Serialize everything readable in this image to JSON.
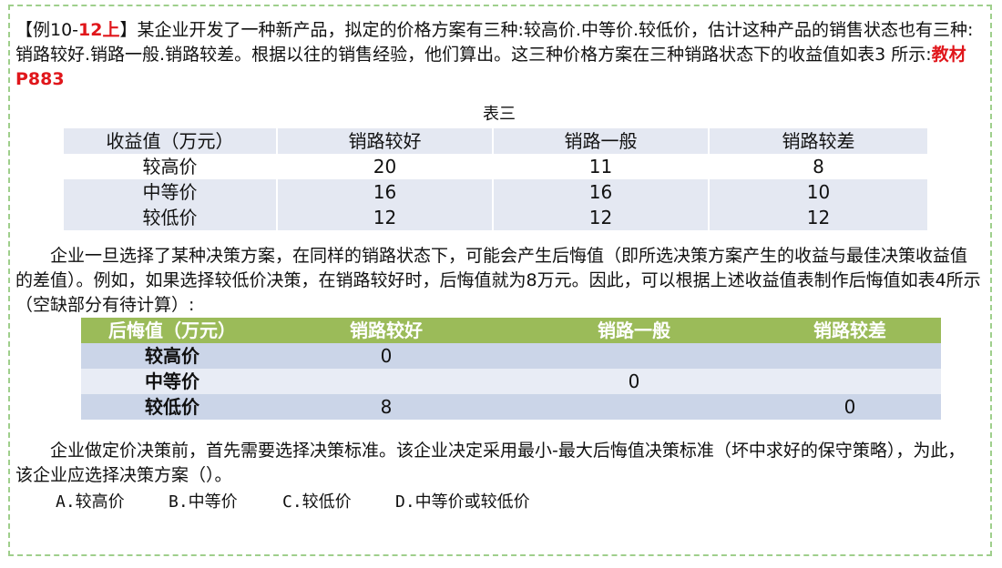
{
  "intro": {
    "prefix": "【例10-",
    "tag": "12上",
    "suffix": "】某企业开发了一种新产品，拟定的价格方案有三种:较高价.中等价.较低价，估计这种产品的销售状态也有三种:销路较好.销路一般.销路较差。根据以往的销售经验，他们算出。这三种价格方案在三种销路状态下的收益值如表3 所示:",
    "ref": "教材P883"
  },
  "table1": {
    "caption": "表三",
    "headers": [
      "收益值（万元）",
      "销路较好",
      "销路一般",
      "销路较差"
    ],
    "rows": [
      [
        "较高价",
        "20",
        "11",
        "8"
      ],
      [
        "中等价",
        "16",
        "16",
        "10"
      ],
      [
        "较低价",
        "12",
        "12",
        "12"
      ]
    ]
  },
  "para2": "　　企业一旦选择了某种决策方案，在同样的销路状态下，可能会产生后悔值（即所选决策方案产生的收益与最佳决策收益值的差值）。例如，如果选择较低价决策，在销路较好时，后悔值就为8万元。因此，可以根据上述收益值表制作后悔值如表4所示（空缺部分有待计算）:",
  "table2": {
    "headers": [
      "后悔值（万元）",
      "销路较好",
      "销路一般",
      "销路较差"
    ],
    "rows": [
      [
        "较高价",
        "0",
        "",
        ""
      ],
      [
        "中等价",
        "",
        "0",
        ""
      ],
      [
        "较低价",
        "8",
        "",
        "0"
      ]
    ]
  },
  "para3": "　　企业做定价决策前，首先需要选择决策标准。该企业决定采用最小-最大后悔值决策标准（坏中求好的保守策略），为此，该企业应选择决策方案（）。",
  "options": [
    "A.较高价",
    "B.中等价",
    "C.较低价",
    "D.中等价或较低价"
  ]
}
